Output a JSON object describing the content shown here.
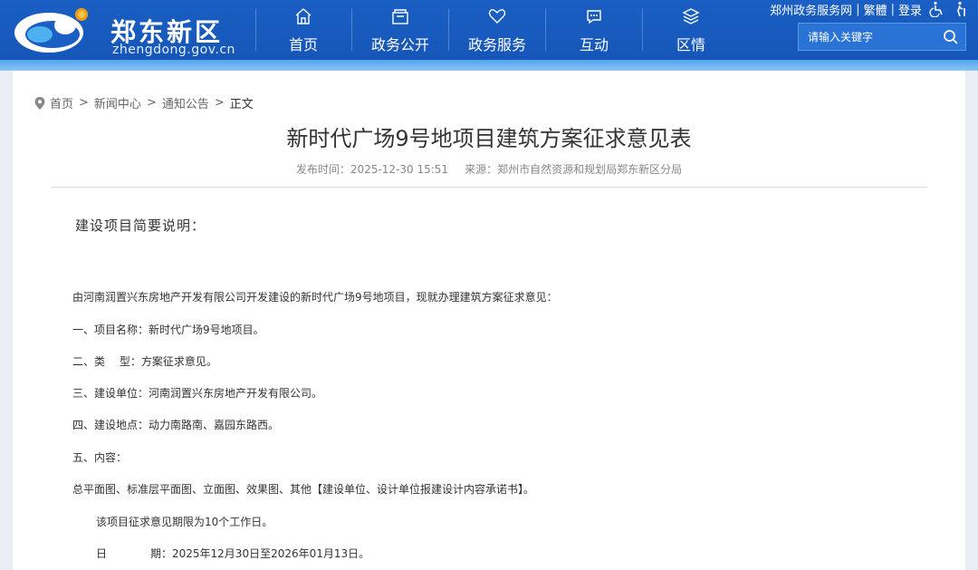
{
  "header": {
    "logo_title": "郑东新区",
    "logo_domain": "zhengdong.gov.cn",
    "nav": [
      {
        "label": "首页",
        "icon": "home-icon"
      },
      {
        "label": "政务公开",
        "icon": "folder-icon"
      },
      {
        "label": "政务服务",
        "icon": "heart-icon"
      },
      {
        "label": "互动",
        "icon": "chat-icon"
      },
      {
        "label": "区情",
        "icon": "layers-icon"
      }
    ],
    "toplinks": {
      "portal": "郑州政务服务网",
      "traditional": "繁體",
      "login": "登录",
      "sep": "|"
    },
    "search": {
      "placeholder": "请输入关键字"
    }
  },
  "breadcrumb": {
    "home": "首页",
    "news": "新闻中心",
    "notices": "通知公告",
    "current": "正文",
    "gt": ">"
  },
  "article": {
    "title": "新时代广场9号地项目建筑方案征求意见表",
    "publish_label": "发布时间：",
    "publish_time": "2025-12-30 15:51",
    "source_label": "来源：",
    "source": "郑州市自然资源和规划局郑东新区分局",
    "intro_heading": "建设项目简要说明：",
    "paragraphs": [
      "由河南润置兴东房地产开发有限公司开发建设的新时代广场9号地项目，现就办理建筑方案征求意见：",
      "一、项目名称：新时代广场9号地项目。",
      "二、类　 型：方案征求意见。",
      "三、建设单位：河南润置兴东房地产开发有限公司。",
      "四、建设地点：动力南路南、嘉园东路西。",
      "五、内容：",
      "总平面图、标准层平面图、立面图、效果图、其他【建设单位、设计单位报建设计内容承诺书】。"
    ],
    "period_note": "该项目征求意见期限为10个工作日。",
    "date_label": "日",
    "date_value": "期：2025年12月30日至2026年01月13日。"
  },
  "colors": {
    "header_blue": "#1a5fc4",
    "stripe_blue": "#6bb5f2",
    "page_bg": "#e9eef5"
  }
}
